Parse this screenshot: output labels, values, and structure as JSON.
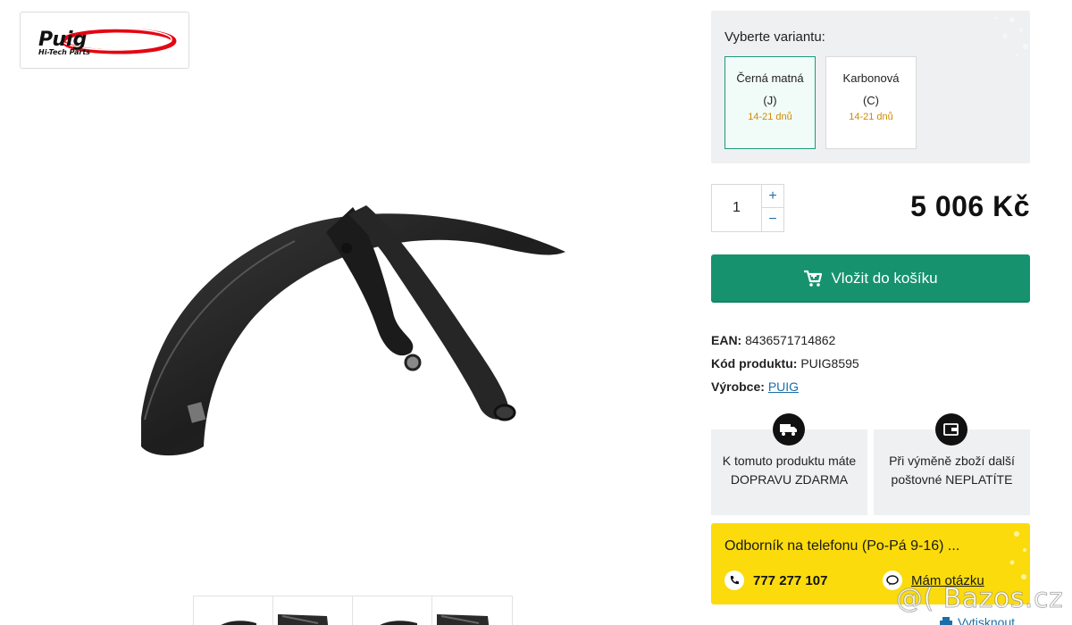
{
  "brand": {
    "logo_word": "Puig",
    "logo_sub": "Hi-Tech Parts",
    "logo_accent": "#e30613"
  },
  "variants": {
    "title": "Vyberte variantu:",
    "options": [
      {
        "name": "Černá matná (J)",
        "delivery": "14-21 dnů",
        "selected": true
      },
      {
        "name": "Karbonová (C)",
        "delivery": "14-21 dnů",
        "selected": false
      }
    ]
  },
  "quantity": {
    "value": "1",
    "plus": "+",
    "minus": "−"
  },
  "price": "5 006 Kč",
  "cart": {
    "label": "Vložit do košíku",
    "icon": "cart-icon",
    "color": "#16926f"
  },
  "meta": {
    "ean_label": "EAN:",
    "ean": "8436571714862",
    "code_label": "Kód produktu:",
    "code": "PUIG8595",
    "maker_label": "Výrobce:",
    "maker": "PUIG"
  },
  "info": [
    {
      "icon": "truck-icon",
      "text": "K tomuto produktu máte DOPRAVU ZDARMA"
    },
    {
      "icon": "wallet-icon",
      "text": "Při výměně zboží další poštovné NEPLATÍTE"
    }
  ],
  "expert": {
    "title": "Odborník na telefonu (Po-Pá 9-16) ...",
    "phone": "777 277 107",
    "question": "Mám otázku",
    "bg": "#fbdb0c"
  },
  "print": "Vytisknout",
  "watermark": "@( Bazos.cz"
}
